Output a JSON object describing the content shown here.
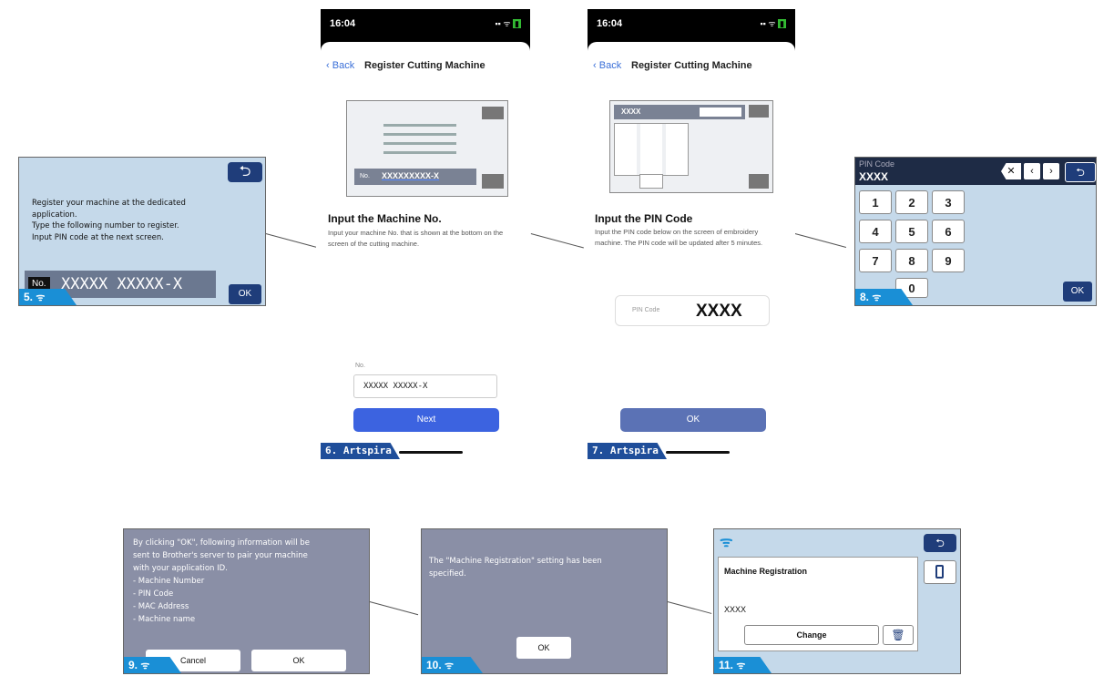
{
  "screen5": {
    "step": "5.",
    "message_lines": [
      "Register your machine at the dedicated",
      "application.",
      "Type the following number to register.",
      "Input PIN code at the next screen."
    ],
    "no_label": "No.",
    "machine_number": "XXXXX XXXXX-X",
    "ok_label": "OK"
  },
  "screen6": {
    "time": "16:04",
    "back_label": "Back",
    "title": "Register Cutting Machine",
    "illus_no_label": "No.",
    "illus_number": "XXXXXXXXX-X",
    "heading": "Input the Machine No.",
    "description": "Input your machine No. that is shown at the bottom on the screen of the cutting machine.",
    "field_label": "No.",
    "field_value": "XXXXX XXXXX-X",
    "next_label": "Next",
    "badge": "6. Artspira"
  },
  "screen7": {
    "time": "16:04",
    "back_label": "Back",
    "title": "Register Cutting Machine",
    "illus_pin": "XXXX",
    "heading": "Input the PIN Code",
    "description": "Input the PIN code below on the screen of embroidery machine. The PIN code will be updated after 5 minutes.",
    "pin_label": "PIN Code",
    "pin_value": "XXXX",
    "ok_label": "OK",
    "badge": "7. Artspira"
  },
  "screen8": {
    "step": "8.",
    "pin_label": "PIN Code",
    "pin_value": "XXXX",
    "keys": [
      "1",
      "2",
      "3",
      "4",
      "5",
      "6",
      "7",
      "8",
      "9",
      "0"
    ],
    "ok_label": "OK"
  },
  "screen9": {
    "step": "9.",
    "message_lines": [
      "By clicking \"OK\", following information will be",
      "sent to Brother's server to pair your machine",
      "with your application ID.",
      "- Machine Number",
      "- PIN Code",
      "- MAC Address",
      "- Machine name"
    ],
    "cancel_label": "Cancel",
    "ok_label": "OK"
  },
  "screen10": {
    "step": "10.",
    "message_lines": [
      "The \"Machine Registration\" setting has been",
      "specified."
    ],
    "ok_label": "OK"
  },
  "screen11": {
    "step": "11.",
    "title": "Machine Registration",
    "value": "XXXX",
    "change_label": "Change"
  },
  "colors": {
    "light_blue_screen": "#c5d9ea",
    "gray_screen": "#8a8fa6",
    "navy_button": "#1f3d7a",
    "step_badge": "#1a8fd6",
    "phone_button": "#3c63e0"
  }
}
